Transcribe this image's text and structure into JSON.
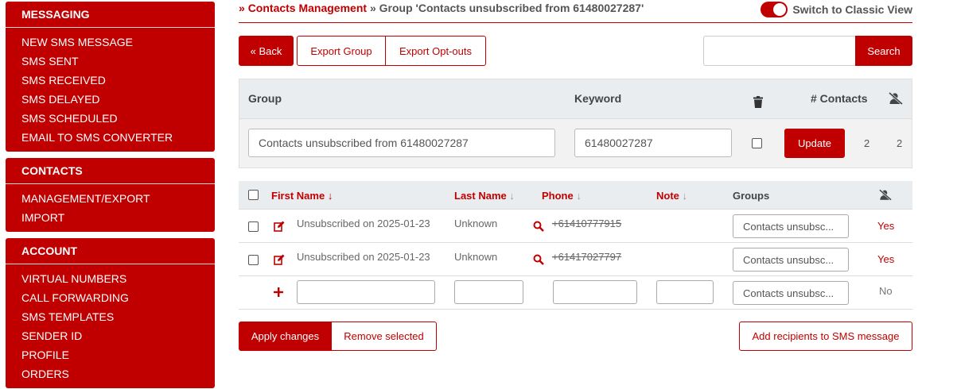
{
  "sidebar": {
    "messaging": {
      "title": "MESSAGING",
      "items": [
        "NEW SMS MESSAGE",
        "SMS SENT",
        "SMS RECEIVED",
        "SMS DELAYED",
        "SMS SCHEDULED",
        "EMAIL TO SMS CONVERTER"
      ]
    },
    "contacts": {
      "title": "CONTACTS",
      "items": [
        "MANAGEMENT/EXPORT",
        "IMPORT"
      ]
    },
    "account": {
      "title": "ACCOUNT",
      "items": [
        "VIRTUAL NUMBERS",
        "CALL FORWARDING",
        "SMS TEMPLATES",
        "SENDER ID",
        "PROFILE",
        "ORDERS"
      ]
    }
  },
  "breadcrumb": {
    "prefix": "»",
    "link": "Contacts Management",
    "separator": "»",
    "current": "Group 'Contacts unsubscribed from 61480027287'"
  },
  "classic_view": {
    "label": "Switch to Classic View",
    "enabled": true
  },
  "toolbar": {
    "back": "« Back",
    "export_group": "Export Group",
    "export_optouts": "Export Opt-outs",
    "search_value": "",
    "search": "Search"
  },
  "group": {
    "headers": {
      "group": "Group",
      "keyword": "Keyword",
      "delete_icon": "trash-icon",
      "contacts": "# Contacts",
      "optout_icon": "user-slash-icon"
    },
    "name": "Contacts unsubscribed from 61480027287",
    "keyword": "61480027287",
    "update": "Update",
    "contacts_count": "2",
    "optout_count": "2"
  },
  "contacts_table": {
    "headers": {
      "first_name": "First Name",
      "last_name": "Last Name",
      "phone": "Phone",
      "note": "Note",
      "groups": "Groups"
    },
    "rows": [
      {
        "first_name": "Unsubscribed on 2025-01-23",
        "last_name": "Unknown",
        "phone": "+61410777915",
        "note": "",
        "groups": "Contacts unsubsc...",
        "optout": "Yes"
      },
      {
        "first_name": "Unsubscribed on 2025-01-23",
        "last_name": "Unknown",
        "phone": "+61417027797",
        "note": "",
        "groups": "Contacts unsubsc...",
        "optout": "Yes"
      }
    ],
    "new_row": {
      "groups": "Contacts unsubsc...",
      "optout": "No"
    }
  },
  "actions": {
    "apply": "Apply changes",
    "remove": "Remove selected",
    "add_recipients": "Add recipients to SMS message"
  },
  "colors": {
    "accent": "#c00000",
    "header_bg": "#eaedf0"
  }
}
